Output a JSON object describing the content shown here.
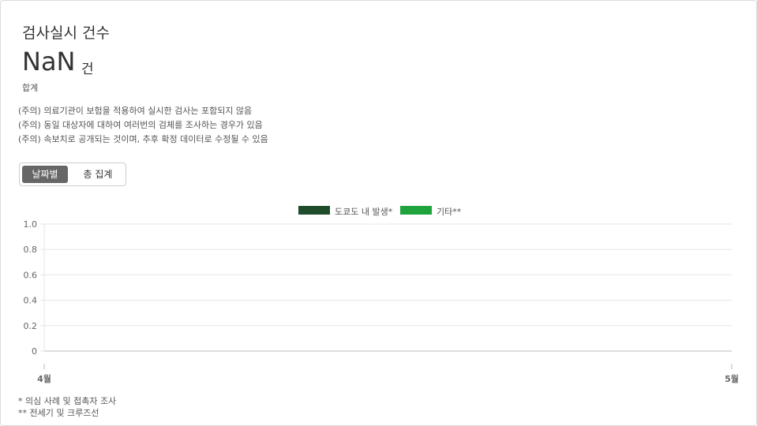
{
  "header": {
    "title": "검사실시 건수",
    "total_value": "NaN",
    "total_unit": "건",
    "subtotal_label": "합계"
  },
  "notes": [
    "(주의) 의료기관이 보험을 적용하여 실시한 검사는 포함되지 않음",
    "(주의) 동일 대상자에 대하여 여러번의 검체를 조사하는 경우가 있음",
    "(주의) 속보치로 공개되는 것이며, 추후 확정 데이터로 수정될 수 있음"
  ],
  "tabs": {
    "daily_label": "날짜별",
    "total_label": "총 집계",
    "selected": "daily"
  },
  "footnotes": [
    "* 의심 사례 및 접촉자 조사",
    "** 전세기 및 크루즈선"
  ],
  "colors": {
    "tokyo": "#1f4d2c",
    "other": "#1fa33c",
    "grid": "#e6e6e6",
    "axis": "#bbbbbb",
    "tab_active_bg": "#666666"
  },
  "chart_data": {
    "type": "bar",
    "stacked": true,
    "x_tick_labels": [
      "4월",
      "5월"
    ],
    "y_ticks": [
      0,
      0.2,
      0.4,
      0.6,
      0.8,
      1.0
    ],
    "y_tick_labels": [
      "0",
      "0.2",
      "0.4",
      "0.6",
      "0.8",
      "1.0"
    ],
    "ylim": [
      0,
      1.0
    ],
    "grid": true,
    "legend_position": "top-center",
    "series": [
      {
        "name": "도쿄도 내 발생*",
        "color": "#1f4d2c",
        "values": []
      },
      {
        "name": "기타**",
        "color": "#1fa33c",
        "values": []
      }
    ]
  }
}
